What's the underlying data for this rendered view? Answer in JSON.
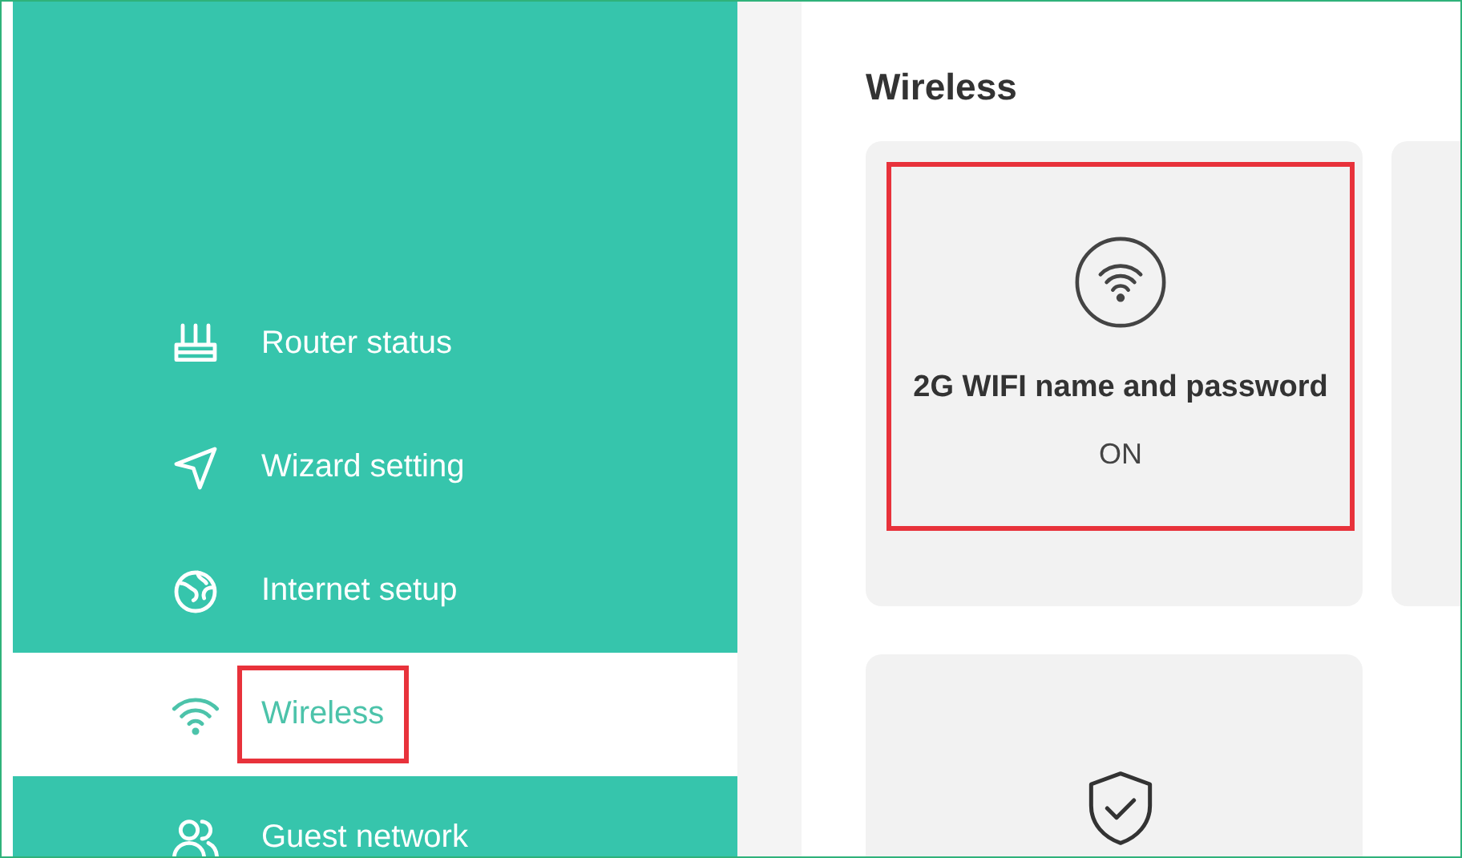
{
  "sidebar": {
    "items": [
      {
        "label": "Router status",
        "kind": "router",
        "selected": false,
        "annotated": false
      },
      {
        "label": "Wizard setting",
        "kind": "wizard",
        "selected": false,
        "annotated": false
      },
      {
        "label": "Internet setup",
        "kind": "internet",
        "selected": false,
        "annotated": false
      },
      {
        "label": "Wireless",
        "kind": "wireless",
        "selected": true,
        "annotated": true
      },
      {
        "label": "Guest network",
        "kind": "guest",
        "selected": false,
        "annotated": false
      }
    ]
  },
  "main": {
    "title": "Wireless",
    "cards": [
      {
        "kind": "wifi",
        "title": "2G WIFI name and password",
        "status": "ON",
        "annotated": true
      },
      {
        "kind": "blank",
        "annotated": false
      },
      {
        "kind": "shield",
        "annotated": false
      }
    ]
  }
}
